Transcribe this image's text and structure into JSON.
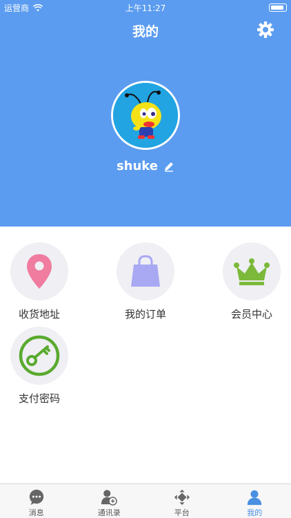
{
  "status_bar": {
    "carrier": "运营商",
    "time": "上午11:27"
  },
  "header": {
    "title": "我的"
  },
  "profile": {
    "username": "shuke"
  },
  "menu": [
    {
      "label": "收货地址",
      "icon": "location-pin-icon",
      "color": "#f07ca0"
    },
    {
      "label": "我的订单",
      "icon": "shopping-bag-icon",
      "color": "#a9a8f3"
    },
    {
      "label": "会员中心",
      "icon": "crown-icon",
      "color": "#7cb93a"
    },
    {
      "label": "支付密码",
      "icon": "key-icon",
      "color": "#5aaa2e"
    }
  ],
  "tabbar": [
    {
      "label": "消息",
      "icon": "chat-bubble-icon",
      "active": false
    },
    {
      "label": "通讯录",
      "icon": "contacts-add-icon",
      "active": false
    },
    {
      "label": "平台",
      "icon": "platform-diamond-icon",
      "active": false
    },
    {
      "label": "我的",
      "icon": "person-icon",
      "active": true
    }
  ],
  "colors": {
    "header_bg": "#5b9cf0",
    "active_tab": "#4a90e2"
  }
}
